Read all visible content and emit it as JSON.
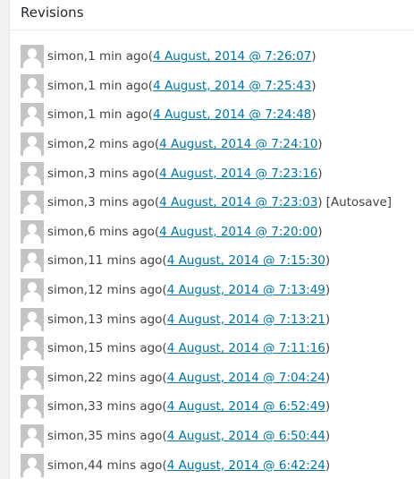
{
  "panel": {
    "title": "Revisions"
  },
  "revisions": [
    {
      "author": "simon",
      "ago": "1 min ago",
      "date": "4 August, 2014 @ 7:26:07",
      "tag": ""
    },
    {
      "author": "simon",
      "ago": "1 min ago",
      "date": "4 August, 2014 @ 7:25:43",
      "tag": ""
    },
    {
      "author": "simon",
      "ago": "1 min ago",
      "date": "4 August, 2014 @ 7:24:48",
      "tag": ""
    },
    {
      "author": "simon",
      "ago": "2 mins ago",
      "date": "4 August, 2014 @ 7:24:10",
      "tag": ""
    },
    {
      "author": "simon",
      "ago": "3 mins ago",
      "date": "4 August, 2014 @ 7:23:16",
      "tag": ""
    },
    {
      "author": "simon",
      "ago": "3 mins ago",
      "date": "4 August, 2014 @ 7:23:03",
      "tag": "[Autosave]"
    },
    {
      "author": "simon",
      "ago": "6 mins ago",
      "date": "4 August, 2014 @ 7:20:00",
      "tag": ""
    },
    {
      "author": "simon",
      "ago": "11 mins ago",
      "date": "4 August, 2014 @ 7:15:30",
      "tag": ""
    },
    {
      "author": "simon",
      "ago": "12 mins ago",
      "date": "4 August, 2014 @ 7:13:49",
      "tag": ""
    },
    {
      "author": "simon",
      "ago": "13 mins ago",
      "date": "4 August, 2014 @ 7:13:21",
      "tag": ""
    },
    {
      "author": "simon",
      "ago": "15 mins ago",
      "date": "4 August, 2014 @ 7:11:16",
      "tag": ""
    },
    {
      "author": "simon",
      "ago": "22 mins ago",
      "date": "4 August, 2014 @ 7:04:24",
      "tag": ""
    },
    {
      "author": "simon",
      "ago": "33 mins ago",
      "date": "4 August, 2014 @ 6:52:49",
      "tag": ""
    },
    {
      "author": "simon",
      "ago": "35 mins ago",
      "date": "4 August, 2014 @ 6:50:44",
      "tag": ""
    },
    {
      "author": "simon",
      "ago": "44 mins ago",
      "date": "4 August, 2014 @ 6:42:24",
      "tag": ""
    }
  ],
  "icons": {
    "avatar": "default-avatar-icon"
  },
  "colors": {
    "link": "#0074a2",
    "text": "#444444",
    "avatar_bg": "#c4c4c4"
  }
}
